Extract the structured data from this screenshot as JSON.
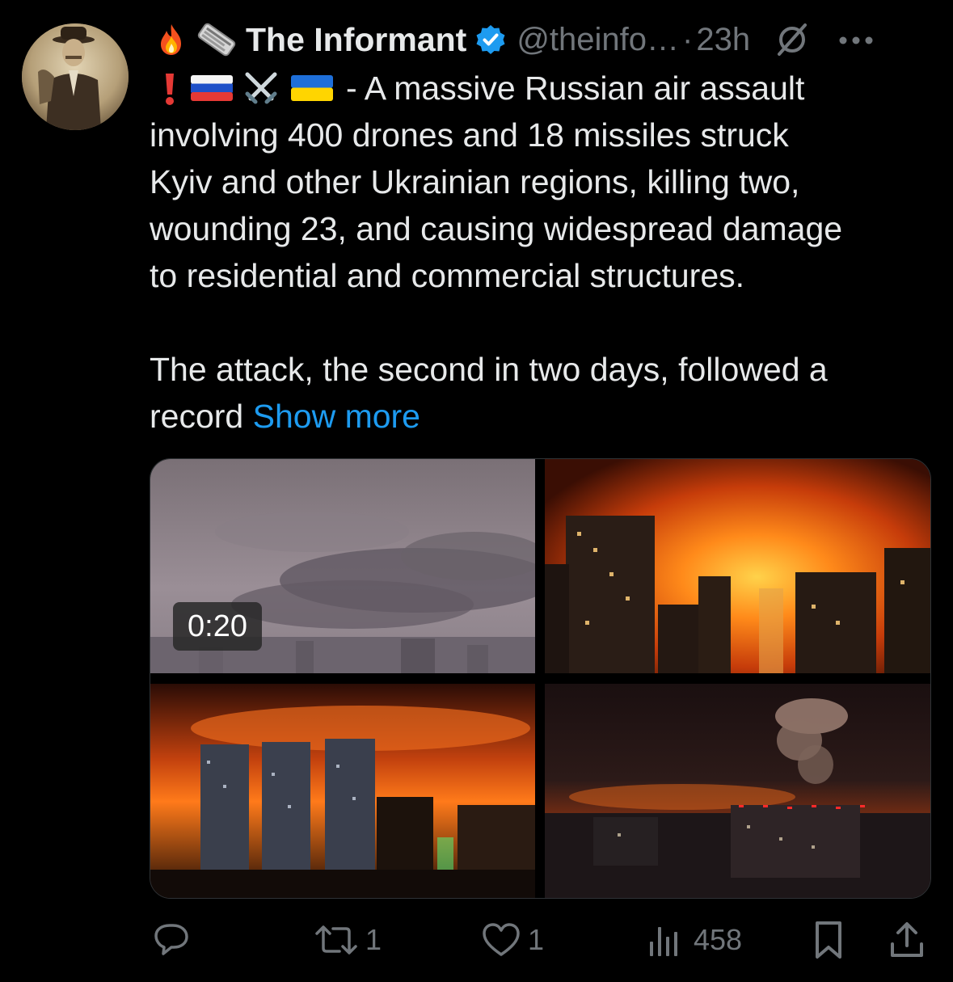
{
  "post": {
    "author": {
      "display_name": "The Informant",
      "handle": "@theinfo…",
      "verified": true,
      "avatar": "vintage-sepia-portrait-avatar"
    },
    "separator": "·",
    "time": "23h",
    "header_emojis": [
      "fire-emoji",
      "newspaper-emoji"
    ],
    "flag_emojis": [
      "exclamation-emoji",
      "russia-flag-emoji",
      "crossed-swords-emoji",
      "ukraine-flag-emoji"
    ],
    "text_lines": [
      "- A massive Russian air assault",
      "involving 400 drones and 18 missiles struck",
      "Kyiv and other Ukrainian regions, killing two,",
      "wounding 23, and causing widespread damage",
      "to residential and commercial structures.",
      "The attack, the second in two days, followed a",
      "record"
    ],
    "show_more": "Show more",
    "media": {
      "video_duration": "0:20",
      "tiles": [
        "smoke-over-city-video",
        "city-fire-glow-photo",
        "city-towers-fire-photo",
        "city-explosion-smoke-photo"
      ]
    },
    "actions": {
      "reply_count": "",
      "repost_count": "1",
      "like_count": "1",
      "views_count": "458"
    }
  },
  "colors": {
    "background": "#000000",
    "text": "#e7e9ea",
    "muted": "#71767b",
    "link": "#1d9bf0",
    "verified": "#1d9bf0"
  }
}
